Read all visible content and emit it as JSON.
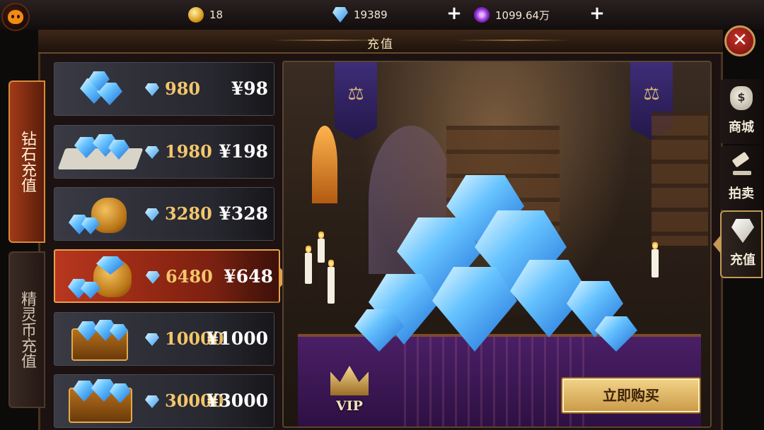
{
  "resources": {
    "gold": "18",
    "diamond": "19389",
    "spirit_coin": "1099.64万"
  },
  "header": {
    "title": "充值"
  },
  "categories": [
    {
      "label": "钻石充值",
      "selected": true
    },
    {
      "label": "精灵币充值",
      "selected": false
    }
  ],
  "packages": [
    {
      "amount": "980",
      "price": "¥98",
      "thumb": "gem-pile-small"
    },
    {
      "amount": "1980",
      "price": "¥198",
      "thumb": "gem-pile-scroll"
    },
    {
      "amount": "3280",
      "price": "¥328",
      "thumb": "gem-bag"
    },
    {
      "amount": "6480",
      "price": "¥648",
      "thumb": "gem-bag-large",
      "selected": true
    },
    {
      "amount": "10000",
      "price": "¥1000",
      "thumb": "gem-chest"
    },
    {
      "amount": "30000",
      "price": "¥3000",
      "thumb": "gem-chest-large"
    }
  ],
  "showcase": {
    "vip_label": "VIP",
    "buy_label": "立即购买"
  },
  "side_nav": [
    {
      "label": "商城",
      "icon": "money-bag-icon"
    },
    {
      "label": "拍卖",
      "icon": "gavel-icon"
    },
    {
      "label": "充值",
      "icon": "diamond-icon",
      "selected": true
    }
  ],
  "colors": {
    "accent_gold": "#e7a14b",
    "selected_red": "#b8361e",
    "amount_gold": "#f2c66b"
  }
}
